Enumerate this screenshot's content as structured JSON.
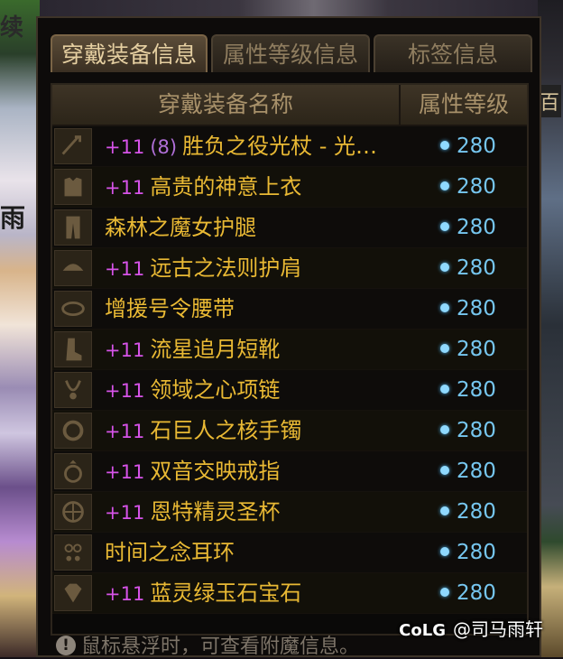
{
  "tabs": [
    {
      "label": "穿戴装备信息",
      "active": true
    },
    {
      "label": "属性等级信息",
      "active": false
    },
    {
      "label": "标签信息",
      "active": false
    }
  ],
  "table": {
    "col_name": "穿戴装备名称",
    "col_level": "属性等级",
    "rows": [
      {
        "icon": "weapon-icon",
        "plus": "+11",
        "rune": "(8)",
        "name": "胜负之役光杖 - 光…",
        "level": "280"
      },
      {
        "icon": "top-icon",
        "plus": "+11",
        "rune": "",
        "name": "高贵的神意上衣",
        "level": "280"
      },
      {
        "icon": "legs-icon",
        "plus": "",
        "rune": "",
        "name": "森林之魔女护腿",
        "level": "280"
      },
      {
        "icon": "shoulder-icon",
        "plus": "+11",
        "rune": "",
        "name": "远古之法则护肩",
        "level": "280"
      },
      {
        "icon": "belt-icon",
        "plus": "",
        "rune": "",
        "name": "增援号令腰带",
        "level": "280"
      },
      {
        "icon": "boots-icon",
        "plus": "+11",
        "rune": "",
        "name": "流星追月短靴",
        "level": "280"
      },
      {
        "icon": "necklace-icon",
        "plus": "+11",
        "rune": "",
        "name": "领域之心项链",
        "level": "280"
      },
      {
        "icon": "bracelet-icon",
        "plus": "+11",
        "rune": "",
        "name": "石巨人之核手镯",
        "level": "280"
      },
      {
        "icon": "ring-icon",
        "plus": "+11",
        "rune": "",
        "name": "双音交映戒指",
        "level": "280"
      },
      {
        "icon": "support-icon",
        "plus": "+11",
        "rune": "",
        "name": "恩特精灵圣杯",
        "level": "280"
      },
      {
        "icon": "earring-icon",
        "plus": "",
        "rune": "",
        "name": "时间之念耳环",
        "level": "280"
      },
      {
        "icon": "gem-icon",
        "plus": "+11",
        "rune": "",
        "name": "蓝灵绿玉石宝石",
        "level": "280"
      }
    ]
  },
  "hint": "鼠标悬浮时，可查看附魔信息。",
  "watermark": {
    "logo": "CoLG",
    "handle": "@司马雨轩"
  },
  "background": {
    "left_top": "续",
    "left_mid": "雨",
    "right_top": "百"
  },
  "colors": {
    "name": "#e9b934",
    "plus": "#d653e8",
    "level": "#76c6ef",
    "tab_active": "#e5cfa1"
  }
}
